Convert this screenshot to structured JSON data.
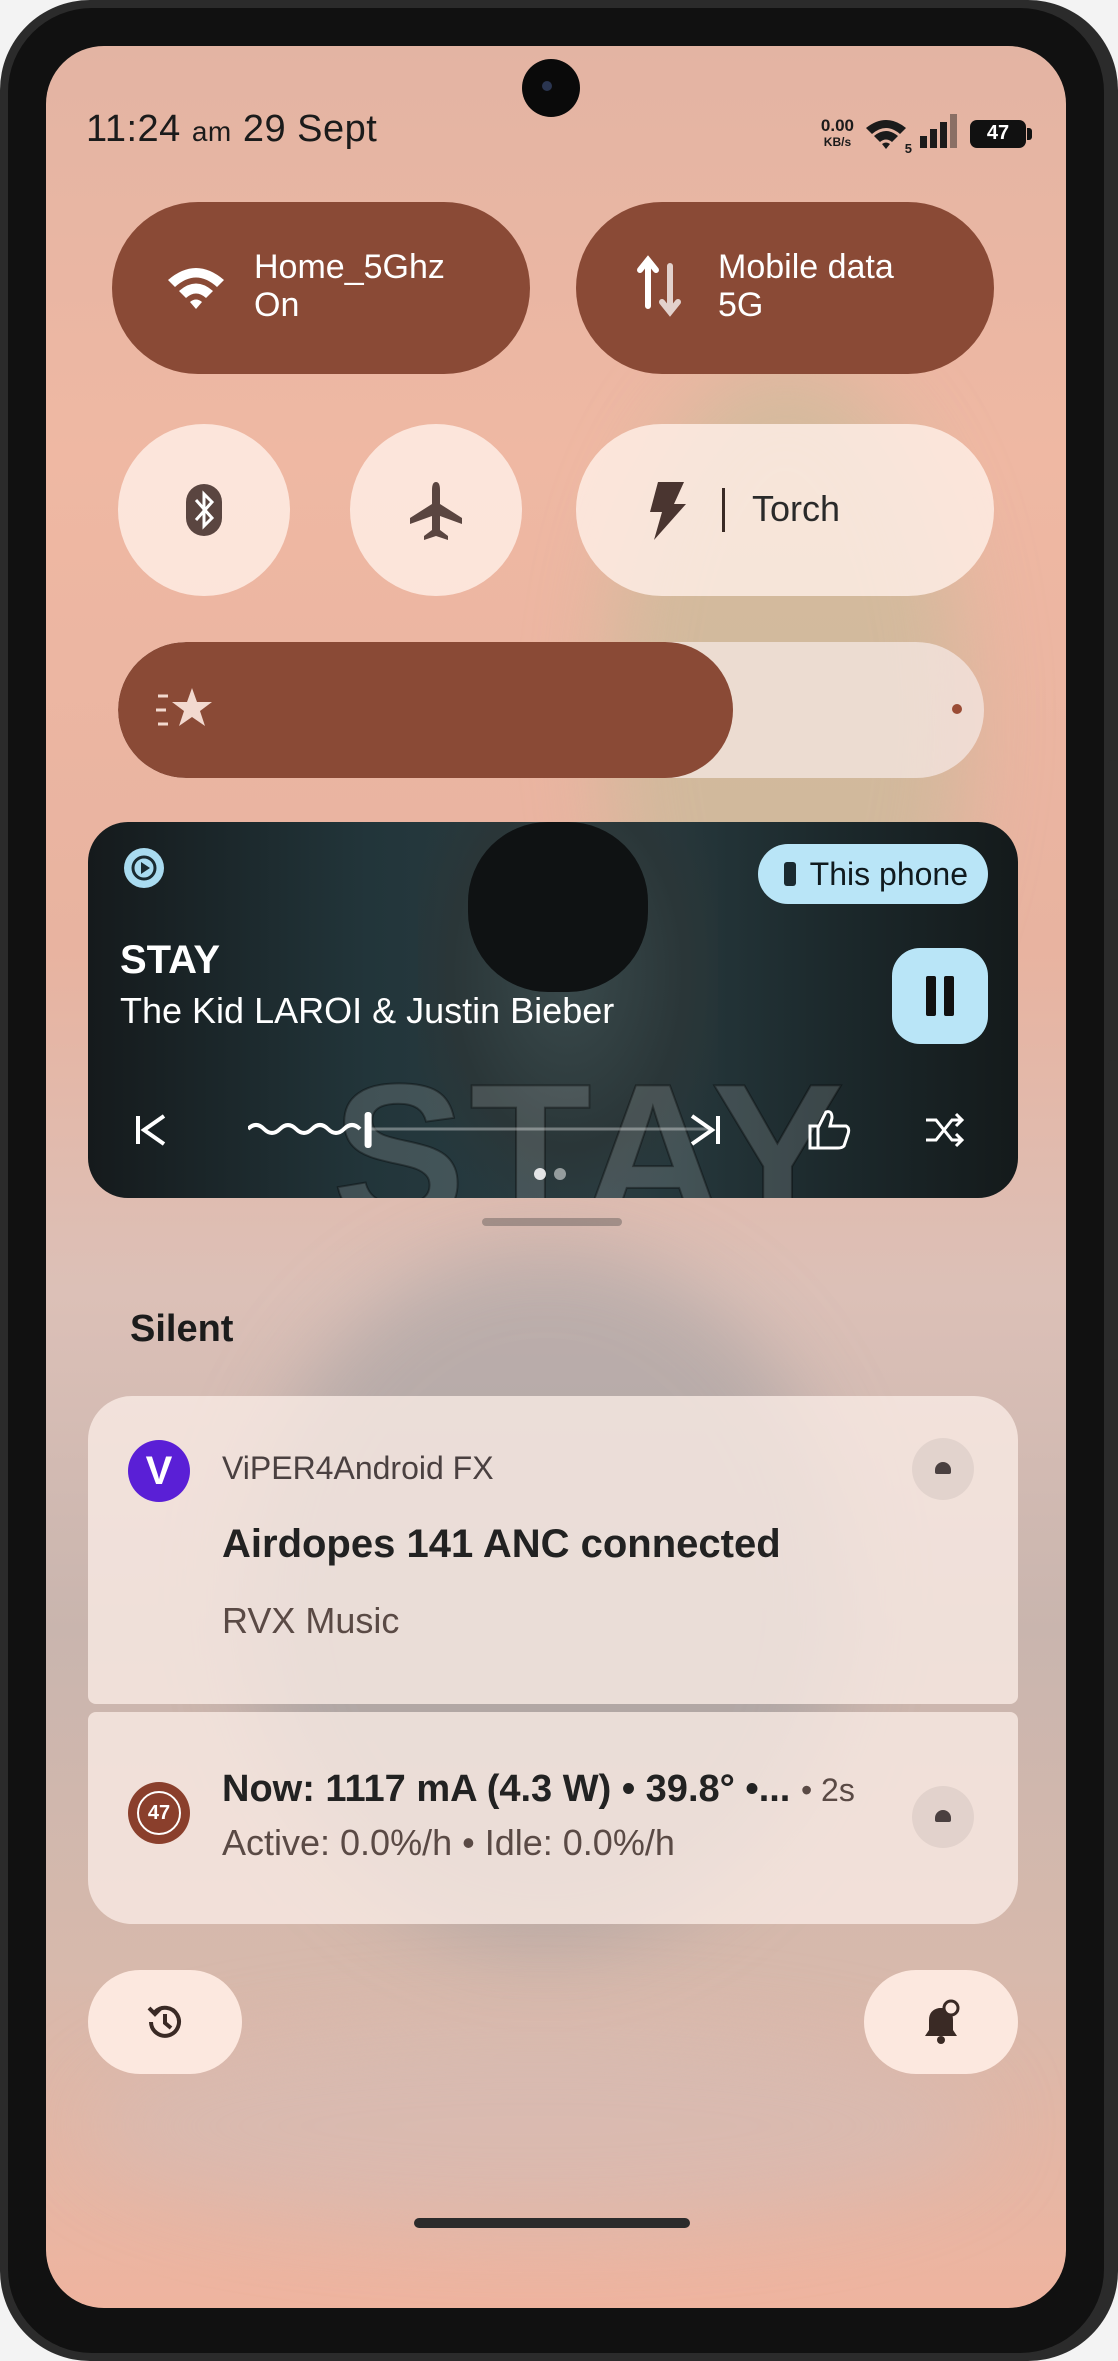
{
  "status_bar": {
    "time": "11:24",
    "ampm": "am",
    "date": "29 Sept",
    "net_speed": "0.00",
    "net_unit": "KB/s",
    "wifi_gen": "5",
    "battery_level": "47"
  },
  "quick_settings": {
    "wifi": {
      "label": "Home_5Ghz",
      "state": "On",
      "icon": "wifi-icon"
    },
    "mobile_data": {
      "label": "Mobile data",
      "state": "5G",
      "icon": "mobile-data-icon"
    },
    "bluetooth": {
      "icon": "bluetooth-icon"
    },
    "airplane": {
      "icon": "airplane-icon"
    },
    "torch": {
      "label": "Torch",
      "icon": "flash-icon"
    },
    "brightness": {
      "level": 0.71,
      "icon": "brightness-star-icon"
    }
  },
  "media": {
    "title": "STAY",
    "artist": "The Kid LAROI & Justin Bieber",
    "output_device": "This phone",
    "background_text": "STAY",
    "progress": 0.26,
    "accent": "#b9e5f7"
  },
  "notifications": {
    "section_title": "Silent",
    "items": [
      {
        "app": "ViPER4Android FX",
        "app_icon_letter": "V",
        "title": "Airdopes 141 ANC connected",
        "text": "RVX Music"
      },
      {
        "battery_badge": "47",
        "title": "Now: 1117 mA (4.3 W) • 39.8° •...",
        "time": "• 2s",
        "text": "Active: 0.0%/h • Idle: 0.0%/h"
      }
    ]
  },
  "colors": {
    "tile_active": "#8a4a36",
    "tile_inactive": "#fff0e8",
    "viper_brand": "#5a1fd6"
  }
}
